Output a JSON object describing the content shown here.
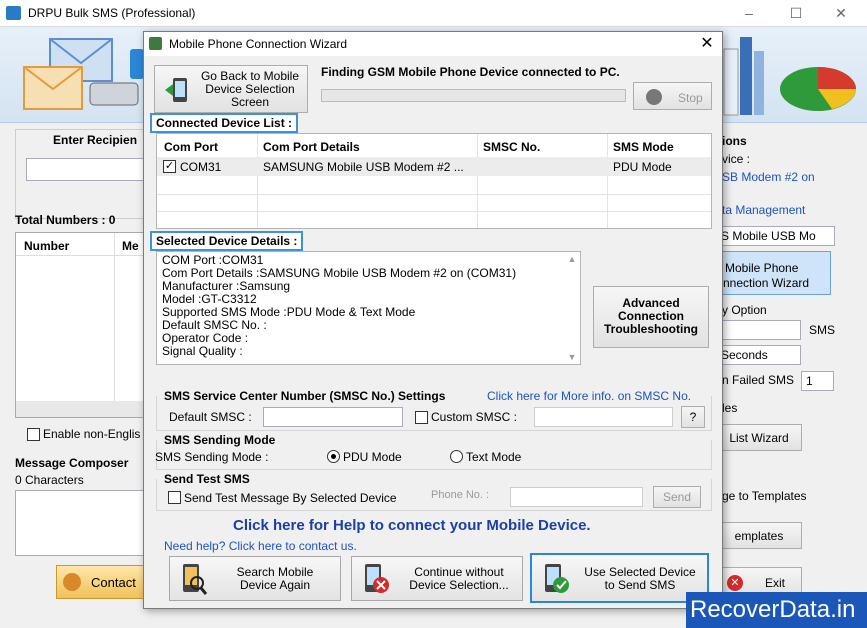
{
  "app": {
    "title": "DRPU Bulk SMS (Professional)",
    "window_controls": [
      "–",
      "☐",
      "✕"
    ],
    "enter_recipient_label": "Enter Recipien",
    "total_numbers": "Total Numbers : 0",
    "col_number": "Number",
    "col_message": "Me",
    "enable_non_english": "Enable non-Englis",
    "message_composer": "Message Composer",
    "characters": "0 Characters",
    "contact_btn": "Contact",
    "right": {
      "options_header": "ions",
      "device_label": "vice :",
      "modem_text": "SB Modem #2 on",
      "data_management": "ta Management",
      "device_select": "S Mobile USB Mo",
      "wizard_line1": "Mobile Phone",
      "wizard_line2": "nnection  Wizard",
      "option_label": "y Option",
      "sms_label": "SMS",
      "seconds": "Seconds",
      "failed_label": "n Failed SMS",
      "failed_value": "1",
      "files_label": "les",
      "list_wizard": "List Wizard",
      "templates_label": "ge to Templates",
      "templates_btn": "emplates",
      "exit_btn": "Exit"
    }
  },
  "dialog": {
    "title": "Mobile Phone Connection Wizard",
    "close": "✕",
    "go_back_btn": [
      "Go Back to Mobile",
      "Device Selection",
      "Screen"
    ],
    "finding_text": "Finding GSM Mobile Phone Device connected to PC.",
    "stop_btn": "Stop",
    "connected_title": "Connected Device List :",
    "table_headers": [
      "Com Port",
      "Com Port Details",
      "SMSC No.",
      "SMS Mode"
    ],
    "table_rows": [
      {
        "checked": true,
        "com_port": "COM31",
        "details": "SAMSUNG Mobile USB Modem #2 ...",
        "smsc": "",
        "mode": "PDU Mode"
      }
    ],
    "selected_title": "Selected Device Details :",
    "details_lines": [
      "COM Port :COM31",
      "Com Port Details :SAMSUNG Mobile USB Modem #2 on (COM31)",
      "Manufacturer :Samsung",
      "Model :GT-C3312",
      "Supported SMS Mode :PDU Mode & Text Mode",
      "Default SMSC No. :",
      "Operator Code :",
      "Signal Quality :"
    ],
    "advanced_btn": [
      "Advanced",
      "Connection",
      "Troubleshooting"
    ],
    "smsc_settings": "SMS Service Center Number (SMSC No.) Settings",
    "smsc_link": "Click here for More info. on SMSC No.",
    "default_smsc": "Default SMSC :",
    "custom_smsc": "Custom SMSC :",
    "help_q": "?",
    "sending_mode_title": "SMS Sending Mode",
    "sending_mode_label": "SMS Sending Mode :",
    "pdu_mode": "PDU Mode",
    "text_mode": "Text Mode",
    "send_test_title": "Send Test SMS",
    "send_test_check": "Send Test Message By Selected Device",
    "phone_no": "Phone No. :",
    "send_btn": "Send",
    "help_banner": "Click here for Help to connect your Mobile Device.",
    "need_help": "Need help? Click here to contact us.",
    "search_btn": [
      "Search Mobile",
      "Device Again"
    ],
    "continue_btn": [
      "Continue without",
      "Device Selection..."
    ],
    "use_btn": [
      "Use Selected Device",
      "to Send SMS"
    ]
  },
  "watermark": "RecoverData.in",
  "colors": {
    "accent": "#3e93d8",
    "help_text": "#1a3fa6",
    "link": "#1a55c0",
    "watermark_bg": "#1a57b8"
  }
}
